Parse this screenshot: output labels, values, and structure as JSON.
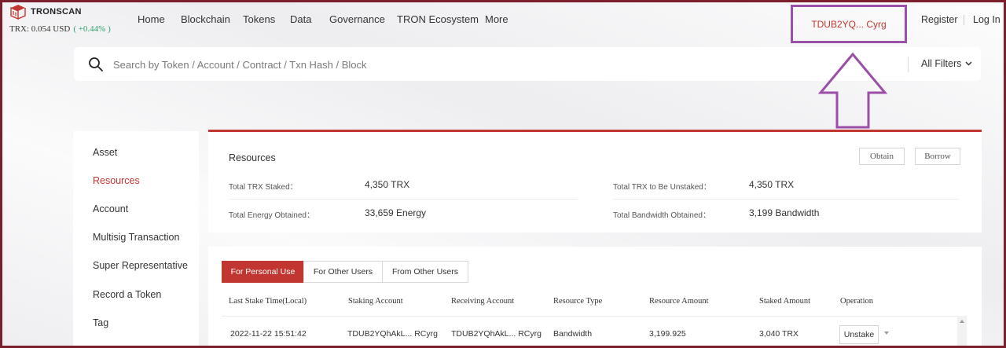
{
  "header": {
    "logo_text": "TRONSCAN",
    "price_label": "TRX: 0.054 USD",
    "price_change": "( +0.44% )",
    "nav": [
      "Home",
      "Blockchain",
      "Tokens",
      "Data",
      "Governance",
      "TRON Ecosystem",
      "More"
    ],
    "account_address": "TDUB2YQ... Cyrg",
    "register": "Register",
    "login": "Log In"
  },
  "search": {
    "placeholder": "Search by Token / Account / Contract / Txn Hash / Block",
    "filters_label": "All Filters"
  },
  "sidebar": {
    "items": [
      "Asset",
      "Resources",
      "Account",
      "Multisig Transaction",
      "Super Representative",
      "Record a Token",
      "Tag"
    ],
    "active": "Resources"
  },
  "resources": {
    "title": "Resources",
    "obtain_button": "Obtain",
    "borrow_button": "Borrow",
    "stats": [
      {
        "label": "Total TRX Staked：",
        "value": "4,350 TRX"
      },
      {
        "label": "Total TRX to Be Unstaked：",
        "value": "4,350 TRX"
      },
      {
        "label": "Total Energy Obtained：",
        "value": "33,659 Energy"
      },
      {
        "label": "Total Bandwidth Obtained：",
        "value": "3,199 Bandwidth"
      }
    ]
  },
  "staking": {
    "tabs": [
      "For Personal Use",
      "For Other Users",
      "From Other Users"
    ],
    "active_tab": "For Personal Use",
    "columns": [
      "Last Stake Time(Local)",
      "Staking Account",
      "Receiving Account",
      "Resource Type",
      "Resource Amount",
      "Staked Amount",
      "Operation"
    ],
    "rows": [
      {
        "time": "2022-11-22 15:51:42",
        "staking_account": "TDUB2YQhAkL... RCyrg",
        "receiving_account": "TDUB2YQhAkL... RCyrg",
        "resource_type": "Bandwidth",
        "resource_amount": "3,199.925",
        "staked_amount": "3,040 TRX",
        "operation": "Unstake"
      }
    ]
  },
  "colors": {
    "accent": "#c23631",
    "highlight": "#9b4fa8",
    "positive": "#2ba36a",
    "frame": "#7a1f2b"
  }
}
